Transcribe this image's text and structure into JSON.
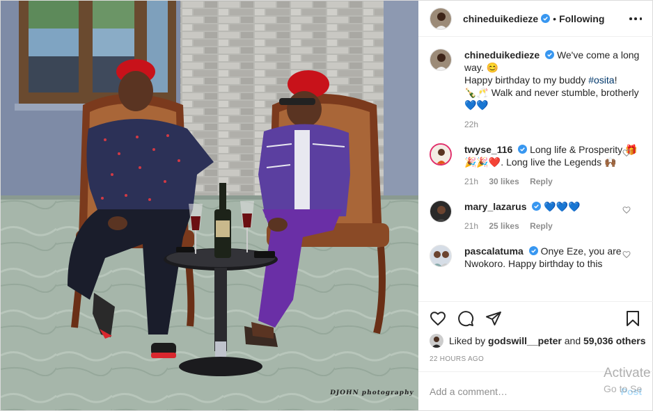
{
  "header": {
    "username": "chineduikedieze",
    "separator": "•",
    "follow_status": "Following"
  },
  "photo": {
    "credit": "DJOHN photography"
  },
  "caption": {
    "username": "chineduikedieze",
    "line1": "We've come a long way. 😊",
    "line2_prefix": "Happy birthday to my buddy ",
    "hashtag": "#osita",
    "line2_suffix": "!",
    "line3": "🍾🥂 Walk and never stumble, brotherly 💙💙",
    "time": "22h"
  },
  "comments": [
    {
      "username": "twyse_116",
      "text": "Long life & Prosperity 🎁🎉🎉❤️. Long live the Legends 🙌🏾",
      "time": "21h",
      "likes": "30 likes",
      "reply": "Reply"
    },
    {
      "username": "mary_lazarus",
      "text": "💙💙💙",
      "time": "21h",
      "likes": "25 likes",
      "reply": "Reply"
    },
    {
      "username": "pascalatuma",
      "text": "Onye Eze, you are Nwokoro. Happy birthday to this"
    }
  ],
  "likes": {
    "prefix": "Liked by ",
    "user": "godswill__peter",
    "middle": " and ",
    "others": "59,036 others"
  },
  "timestamp": "22 HOURS AGO",
  "add_comment": {
    "placeholder": "Add a comment…",
    "post_label": "Post"
  },
  "watermark": {
    "line1": "Activate",
    "line2": "Go to Se"
  },
  "colors": {
    "verified": "#3897f0",
    "hashtag": "#00376b",
    "muted": "#8e8e8e",
    "post_disabled": "#b2dffc"
  },
  "icons": [
    "heart-icon",
    "comment-icon",
    "share-icon",
    "bookmark-icon",
    "more-icon",
    "verified-badge-icon"
  ]
}
